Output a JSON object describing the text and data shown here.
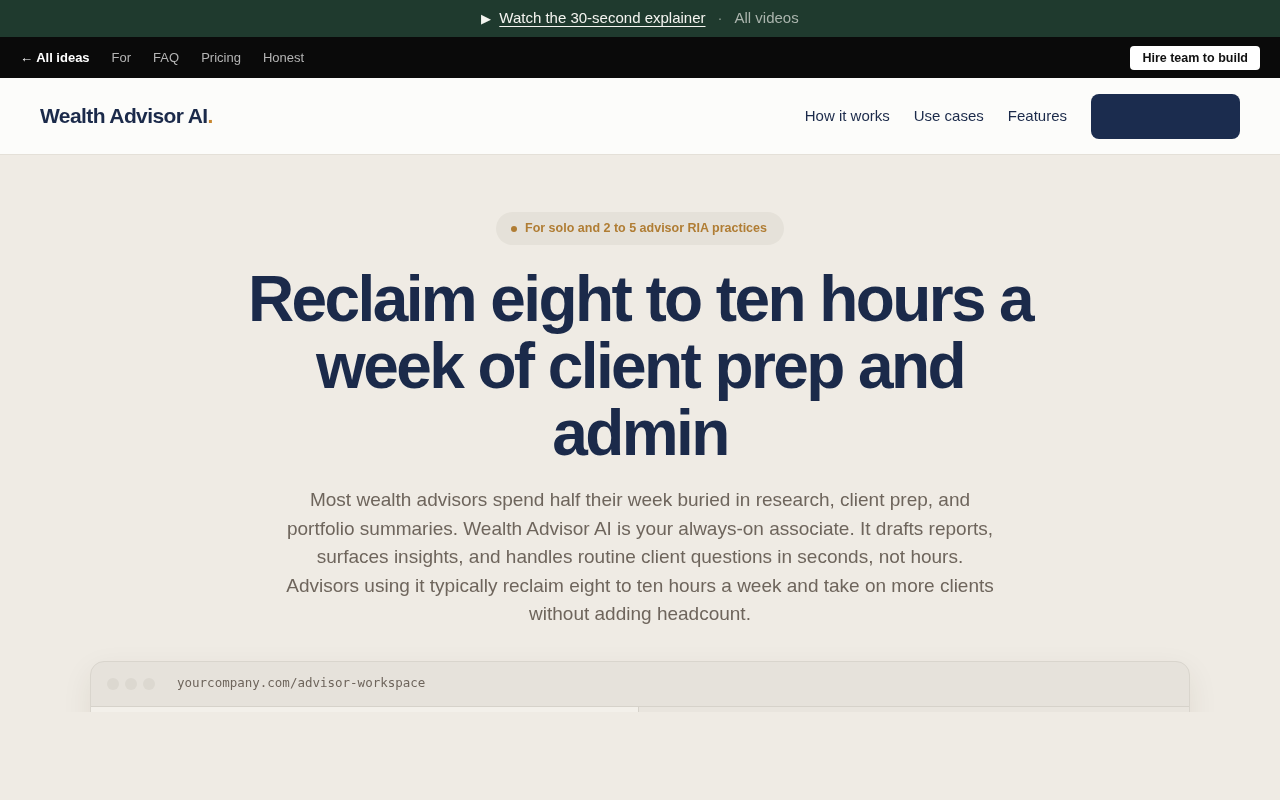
{
  "announcement": {
    "play_glyph": "▶",
    "link": "Watch the 30-second explainer",
    "separator": "·",
    "secondary_link": "All videos"
  },
  "top_nav": {
    "back_link": "← All ideas",
    "links": [
      "For",
      "FAQ",
      "Pricing",
      "Honest"
    ],
    "button": "Hire team to build"
  },
  "header": {
    "brand": "Wealth Advisor AI",
    "brand_mark": ".",
    "nav": [
      "How it works",
      "Use cases",
      "Features"
    ]
  },
  "hero": {
    "badge": "For solo and 2 to 5 advisor RIA practices",
    "title": "Reclaim eight to ten hours a week of client prep and admin",
    "description": "Most wealth advisors spend half their week buried in research, client prep, and portfolio summaries. Wealth Advisor AI is your always-on associate. It drafts reports, surfaces insights, and handles routine client questions in seconds, not hours. Advisors using it typically reclaim eight to ten hours a week and take on more clients without adding headcount."
  },
  "mockup": {
    "url": "yourcompany.com/advisor-workspace"
  }
}
